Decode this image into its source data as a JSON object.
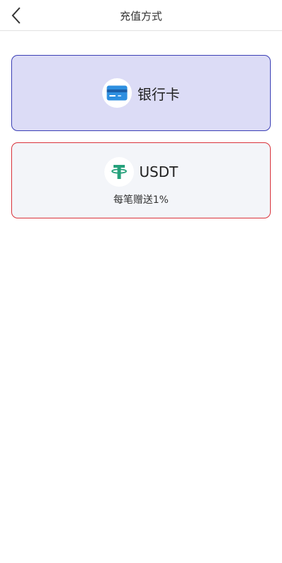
{
  "header": {
    "title": "充值方式"
  },
  "methods": [
    {
      "id": "bank",
      "label": "银行卡",
      "icon": "bank-card-icon",
      "bg_color": "#dcdcf6",
      "border_color": "#3b3fb5"
    },
    {
      "id": "usdt",
      "label": "USDT",
      "icon": "tether-icon",
      "bonus": "每笔赠送1%",
      "bg_color": "#f3f5f9",
      "border_color": "#d9323a",
      "icon_color": "#26a17b"
    }
  ]
}
